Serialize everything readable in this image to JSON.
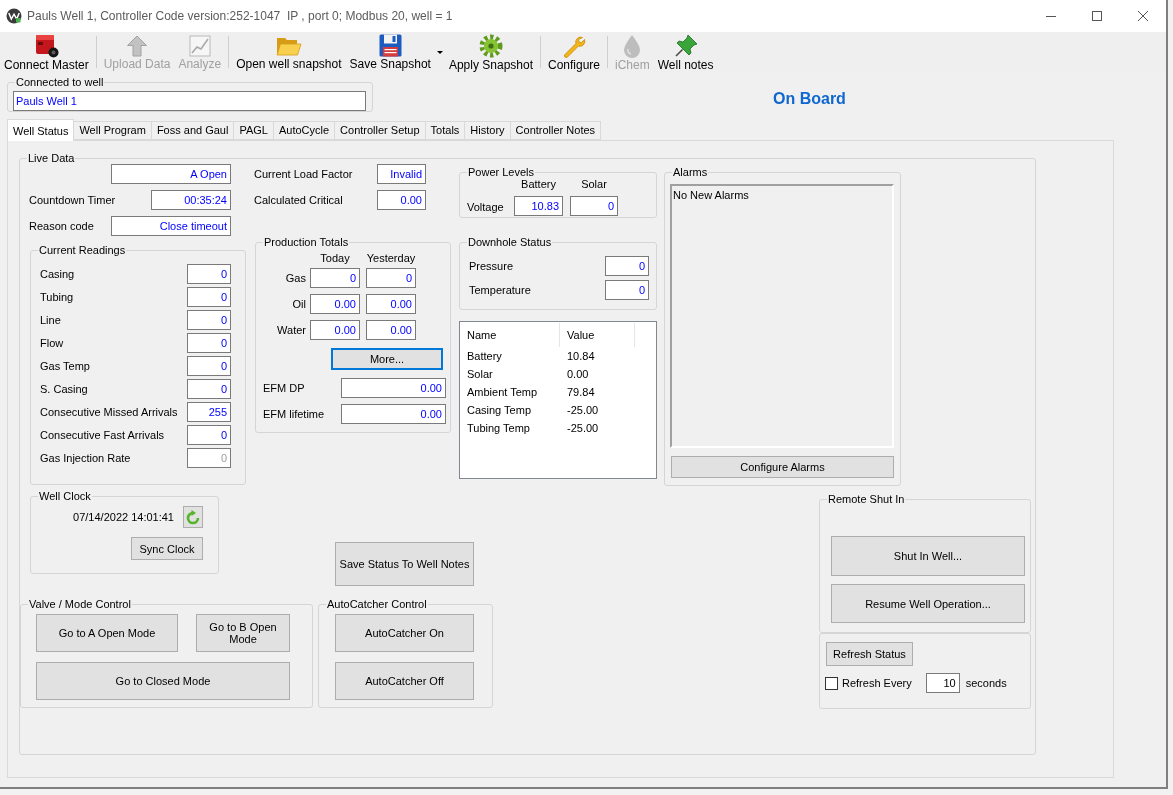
{
  "window": {
    "title": "Pauls Well 1, Controller Code version:252-1047  IP , port 0; Modbus 20, well = 1"
  },
  "toolbar": [
    {
      "kind": "button",
      "label": "Connect Master",
      "disabled": false
    },
    {
      "kind": "separator"
    },
    {
      "kind": "button",
      "label": "Upload Data",
      "disabled": true
    },
    {
      "kind": "button",
      "label": "Analyze",
      "disabled": true
    },
    {
      "kind": "separator"
    },
    {
      "kind": "button",
      "label": "Open well snapshot",
      "disabled": false
    },
    {
      "kind": "split",
      "label": "Save Snapshot",
      "disabled": false
    },
    {
      "kind": "button",
      "label": "Apply Snapshot",
      "disabled": false
    },
    {
      "kind": "separator"
    },
    {
      "kind": "button",
      "label": "Configure",
      "disabled": false
    },
    {
      "kind": "separator"
    },
    {
      "kind": "button",
      "label": "iChem",
      "disabled": true
    },
    {
      "kind": "button",
      "label": "Well notes",
      "disabled": false
    }
  ],
  "connection": {
    "label": "Connected to well",
    "value": "Pauls Well 1"
  },
  "board_status": "On Board",
  "tabs": [
    {
      "label": "Well Status",
      "selected": true
    },
    {
      "label": "Well Program",
      "selected": false
    },
    {
      "label": "Foss and Gaul",
      "selected": false
    },
    {
      "label": "PAGL",
      "selected": false
    },
    {
      "label": "AutoCycle",
      "selected": false
    },
    {
      "label": "Controller Setup",
      "selected": false
    },
    {
      "label": "Totals",
      "selected": false
    },
    {
      "label": "History",
      "selected": false
    },
    {
      "label": "Controller Notes",
      "selected": false
    }
  ],
  "live_data": {
    "title": "Live Data",
    "mode_value": "A Open",
    "countdown_timer": {
      "label": "Countdown Timer",
      "value": "00:35:24"
    },
    "reason_code": {
      "label": "Reason code",
      "value": "Close timeout"
    },
    "current_readings": {
      "title": "Current Readings",
      "rows": [
        {
          "label": "Casing",
          "value": "0",
          "disabled": false
        },
        {
          "label": "Tubing",
          "value": "0",
          "disabled": false
        },
        {
          "label": "Line",
          "value": "0",
          "disabled": false
        },
        {
          "label": "Flow",
          "value": "0",
          "disabled": false
        },
        {
          "label": "Gas Temp",
          "value": "0",
          "disabled": false
        },
        {
          "label": "S. Casing",
          "value": "0",
          "disabled": false
        },
        {
          "label": "Consecutive Missed Arrivals",
          "value": "255",
          "disabled": false
        },
        {
          "label": "Consecutive Fast Arrivals",
          "value": "0",
          "disabled": false
        },
        {
          "label": "Gas Injection Rate",
          "value": "0",
          "disabled": true
        }
      ]
    },
    "load_factor": {
      "label": "Current Load Factor",
      "value": "Invalid"
    },
    "calculated_critical": {
      "label": "Calculated Critical",
      "value": "0.00"
    },
    "production_totals": {
      "title": "Production Totals",
      "columns": [
        "Today",
        "Yesterday"
      ],
      "rows": [
        {
          "label": "Gas",
          "today": "0",
          "yesterday": "0"
        },
        {
          "label": "Oil",
          "today": "0.00",
          "yesterday": "0.00"
        },
        {
          "label": "Water",
          "today": "0.00",
          "yesterday": "0.00"
        }
      ],
      "more_button": {
        "label": "More...",
        "focused": true
      },
      "efm": [
        {
          "label": "EFM DP",
          "value": "0.00"
        },
        {
          "label": "EFM lifetime",
          "value": "0.00"
        }
      ]
    },
    "power_levels": {
      "title": "Power Levels",
      "columns": [
        "Battery",
        "Solar"
      ],
      "row_label": "Voltage",
      "values": [
        "10.83",
        "0"
      ]
    },
    "downhole_status": {
      "title": "Downhole Status",
      "rows": [
        {
          "label": "Pressure",
          "value": "0"
        },
        {
          "label": "Temperature",
          "value": "0"
        }
      ]
    },
    "sensor_table": {
      "columns": [
        "Name",
        "Value"
      ],
      "rows": [
        {
          "name": "Battery",
          "value": "10.84"
        },
        {
          "name": "Solar",
          "value": "0.00"
        },
        {
          "name": "Ambient Temp",
          "value": "79.84"
        },
        {
          "name": "Casing Temp",
          "value": "-25.00"
        },
        {
          "name": "Tubing Temp",
          "value": "-25.00"
        }
      ]
    },
    "alarms": {
      "title": "Alarms",
      "items": [
        "No New Alarms"
      ],
      "button": "Configure Alarms"
    },
    "well_clock": {
      "title": "Well Clock",
      "datetime": "07/14/2022 14:01:41",
      "sync_button": "Sync Clock"
    },
    "save_status_button": "Save Status To Well Notes",
    "valve_mode_control": {
      "title": "Valve / Mode Control",
      "buttons": [
        "Go to A Open Mode",
        "Go to B Open Mode",
        "Go to Closed Mode"
      ]
    },
    "autocatcher_control": {
      "title": "AutoCatcher Control",
      "buttons": [
        "AutoCatcher On",
        "AutoCatcher Off"
      ]
    },
    "remote_shut_in": {
      "title": "Remote Shut In",
      "buttons": [
        "Shut In Well...",
        "Resume Well Operation..."
      ]
    },
    "refresh": {
      "button": "Refresh Status",
      "checkbox": {
        "label": "Refresh Every",
        "checked": false
      },
      "interval": "10",
      "unit": "seconds"
    }
  }
}
